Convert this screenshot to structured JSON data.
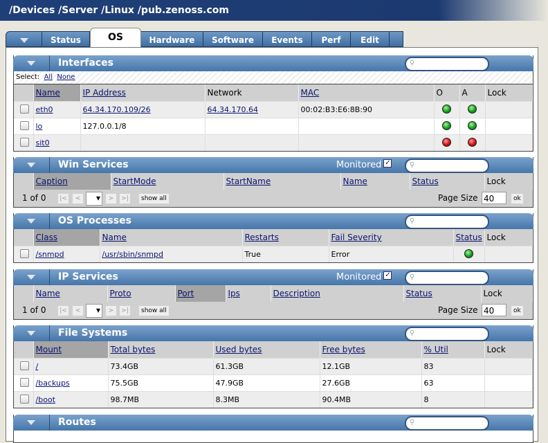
{
  "breadcrumb": "/Devices /Server /Linux /pub.zenoss.com",
  "tabs": [
    "Status",
    "OS",
    "Hardware",
    "Software",
    "Events",
    "Perf",
    "Edit"
  ],
  "interfaces": {
    "title": "Interfaces",
    "select_label": "Select:",
    "all": "All",
    "none": "None",
    "columns": [
      "Name",
      "IP Address",
      "Network",
      "MAC",
      "O",
      "A",
      "Lock"
    ],
    "rows": [
      {
        "name": "eth0",
        "ip": "64.34.170.109/26",
        "network": "64.34.170.64",
        "mac": "00:02:B3:E6:8B:90",
        "o": "green",
        "a": "green"
      },
      {
        "name": "lo",
        "ip": "127.0.0.1/8",
        "network": "",
        "mac": "",
        "o": "green",
        "a": "green"
      },
      {
        "name": "sit0",
        "ip": "",
        "network": "",
        "mac": "",
        "o": "red",
        "a": "red"
      }
    ]
  },
  "win_services": {
    "title": "Win Services",
    "monitored": "Monitored",
    "columns": [
      "Caption",
      "StartMode",
      "StartName",
      "Name",
      "Status",
      "Lock"
    ],
    "pager": {
      "count": "1 of 0",
      "show_all": "show all",
      "page_size_label": "Page Size",
      "page_size": "40",
      "ok": "ok"
    }
  },
  "os_processes": {
    "title": "OS Processes",
    "columns": [
      "Class",
      "Name",
      "Restarts",
      "Fail Severity",
      "Status",
      "Lock"
    ],
    "rows": [
      {
        "class": "/snmpd",
        "name": "/usr/sbin/snmpd",
        "restarts": "True",
        "fail_severity": "Error",
        "status": "green"
      }
    ]
  },
  "ip_services": {
    "title": "IP Services",
    "monitored": "Monitored",
    "columns": [
      "Name",
      "Proto",
      "Port",
      "Ips",
      "Description",
      "Status",
      "Lock"
    ],
    "pager": {
      "count": "1 of 0",
      "show_all": "show all",
      "page_size_label": "Page Size",
      "page_size": "40",
      "ok": "ok"
    }
  },
  "file_systems": {
    "title": "File Systems",
    "columns": [
      "Mount",
      "Total bytes",
      "Used bytes",
      "Free bytes",
      "% Util",
      "Lock"
    ],
    "rows": [
      {
        "mount": "/",
        "total": "73.4GB",
        "used": "61.3GB",
        "free": "12.1GB",
        "util": "83"
      },
      {
        "mount": "/backups",
        "total": "75.5GB",
        "used": "47.9GB",
        "free": "27.6GB",
        "util": "63"
      },
      {
        "mount": "/boot",
        "total": "98.7MB",
        "used": "8.3MB",
        "free": "90.4MB",
        "util": "8"
      }
    ]
  },
  "routes": {
    "title": "Routes"
  },
  "colors": {
    "header": "#1f3f78",
    "section": "#4676aa"
  }
}
